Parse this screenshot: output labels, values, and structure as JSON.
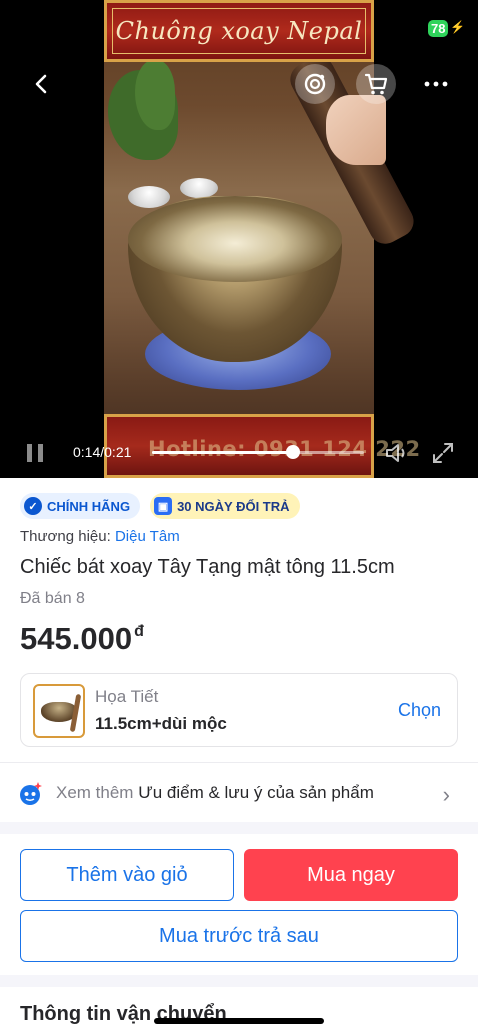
{
  "status_bar": {
    "battery": "78"
  },
  "video": {
    "banner_title": "Chuông xoay Nepal",
    "hotline_text": "Hotline: 0931 124 222",
    "time_current": "0:14",
    "time_total": "0:21",
    "time_sep": "/",
    "progress": 0.667
  },
  "icons": {
    "back": "chevron-left-icon",
    "image_search": "camera-search-icon",
    "cart": "cart-icon",
    "more": "more-dots-icon",
    "pause": "pause-icon",
    "volume": "volume-icon",
    "fullscreen": "fullscreen-icon"
  },
  "badges": {
    "authentic": "CHÍNH HÃNG",
    "return": "30 NGÀY ĐỔI TRẢ"
  },
  "product": {
    "brand_label": "Thương hiệu: ",
    "brand_name": "Diệu Tâm",
    "title": "Chiếc bát xoay Tây Tạng mật tông 11.5cm",
    "sold": "Đã bán 8",
    "price": "545.000",
    "currency": "đ"
  },
  "variant": {
    "label": "Họa Tiết",
    "value": "11.5cm+dùi mộc",
    "action": "Chọn"
  },
  "see_more": {
    "prefix": "Xem thêm ",
    "text": "Ưu điểm & lưu ý của sản phẩm"
  },
  "actions": {
    "add_to_cart": "Thêm vào giỏ",
    "buy_now": "Mua ngay",
    "buy_later": "Mua trước trả sau"
  },
  "shipping": {
    "title": "Thông tin vận chuyển"
  },
  "colors": {
    "accent_blue": "#1a73e8",
    "buy_red": "#ff424f",
    "badge_yellow": "#fff3b8"
  }
}
